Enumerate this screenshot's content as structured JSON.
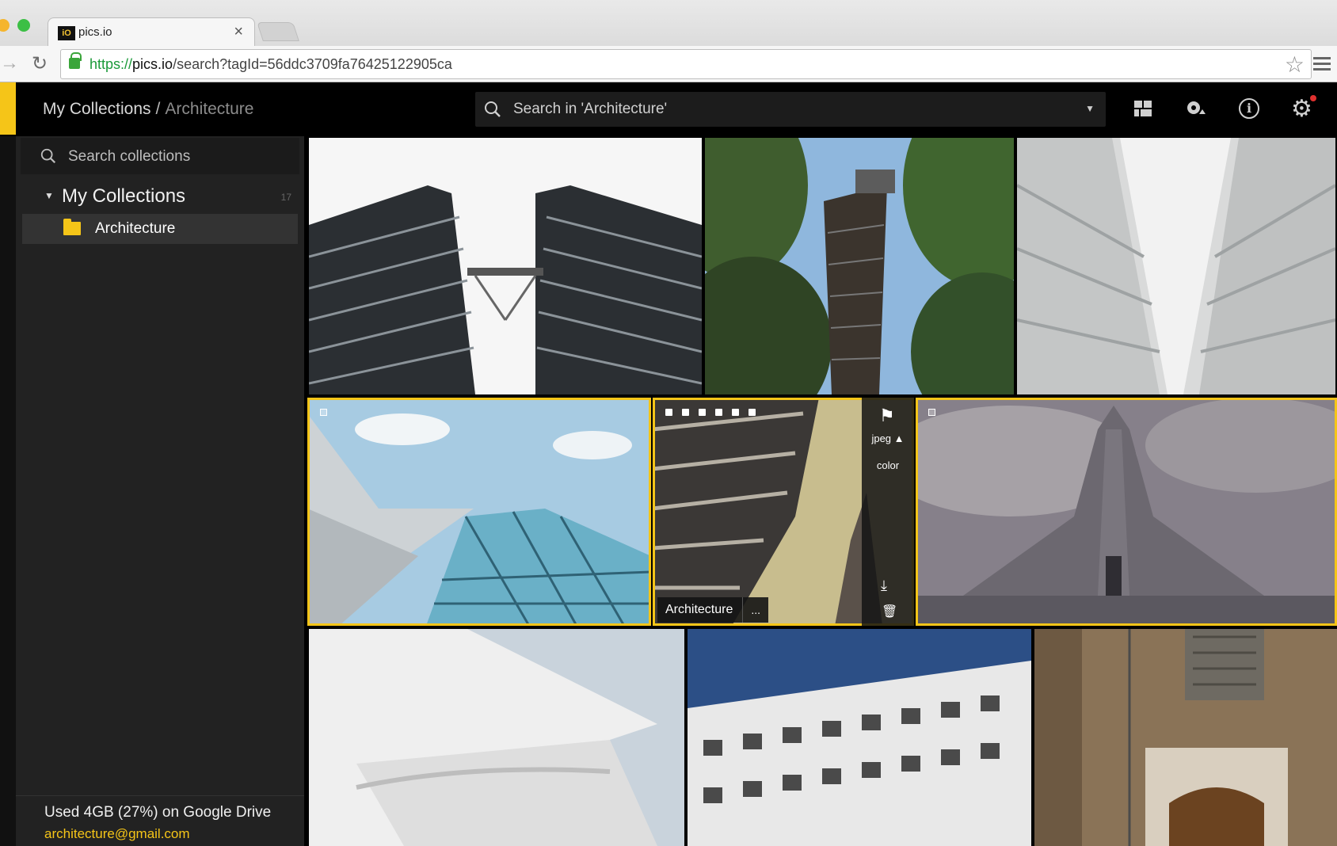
{
  "browser": {
    "tab_title": "pics.io",
    "favicon_text": "iO",
    "tab_close": "×",
    "url_scheme": "https://",
    "url_host": "pics.io",
    "url_path": "/search?tagId=56ddc3709fa76425122905ca"
  },
  "header": {
    "breadcrumb_root": "My Collections",
    "breadcrumb_sep": "/",
    "breadcrumb_current": "Architecture",
    "search_placeholder": "Search in 'Architecture'"
  },
  "sidebar": {
    "search_placeholder": "Search collections",
    "root_label": "My Collections",
    "root_count": "17",
    "items": [
      {
        "label": "Architecture"
      }
    ],
    "usage": "Used 4GB (27%) on Google Drive",
    "email": "architecture@gmail.com"
  },
  "selected_tile": {
    "format": "jpeg",
    "color_label": "color",
    "collection_tag": "Architecture",
    "more": "..."
  },
  "colors": {
    "accent": "#f5c518",
    "app_bg": "#000000",
    "sidebar_bg": "#222222"
  }
}
